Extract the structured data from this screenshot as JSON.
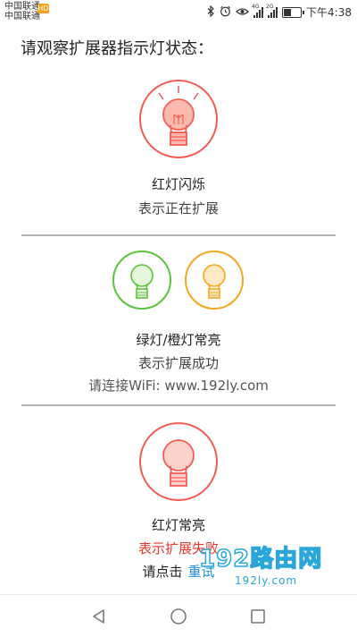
{
  "status_bar": {
    "carrier_1": "中国联通",
    "carrier_2": "中国联通",
    "hd_badge": "HD",
    "net_1": "4G",
    "net_2": "2G",
    "time": "下午4:38",
    "battery_level": 0.45
  },
  "instruction": "请观察扩展器指示灯状态：",
  "states": [
    {
      "title": "红灯闪烁",
      "desc": "表示正在扩展",
      "bulb_color": "#f25c54"
    },
    {
      "title": "绿灯/橙灯常亮",
      "desc": "表示扩展成功",
      "hint": "请连接WiFi: www.192ly.com",
      "bulb_colors": [
        "#5ac43a",
        "#f5a623"
      ]
    },
    {
      "title": "红灯常亮",
      "desc": "表示扩展失败",
      "retry_prefix": "请点击",
      "retry_link": "重试",
      "bulb_color": "#f25c54"
    }
  ],
  "watermark": {
    "big": "192路由网",
    "small": "192ly.com"
  },
  "colors": {
    "red": "#f25c54",
    "green": "#5ac43a",
    "orange": "#f5a623",
    "link": "#1a8fd4",
    "fail": "#e8372c"
  }
}
